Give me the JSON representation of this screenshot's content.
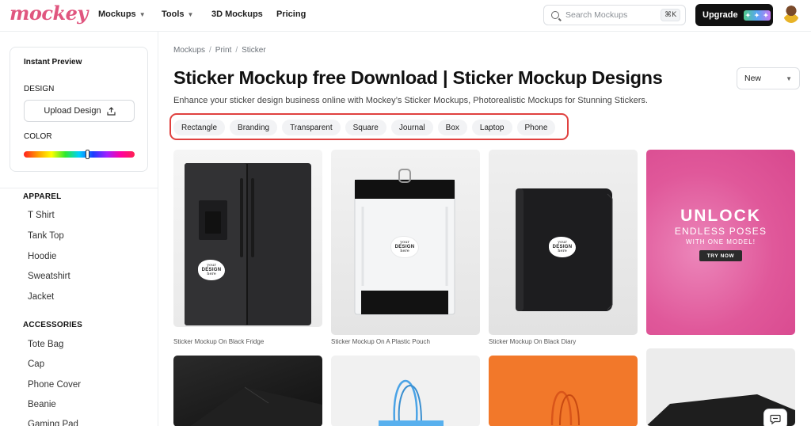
{
  "brand": {
    "logo": "mockey"
  },
  "nav": {
    "items": [
      {
        "label": "Mockups",
        "dropdown": true
      },
      {
        "label": "Tools",
        "dropdown": true
      },
      {
        "label": "3D Mockups",
        "dropdown": false
      },
      {
        "label": "Pricing",
        "dropdown": false
      }
    ]
  },
  "search": {
    "placeholder": "Search Mockups",
    "shortcut": "⌘K"
  },
  "upgrade": {
    "label": "Upgrade"
  },
  "sidebar": {
    "preview": {
      "title": "Instant Preview",
      "design_label": "DESIGN",
      "upload_label": "Upload Design",
      "color_label": "COLOR"
    },
    "sections": [
      {
        "heading": "APPAREL",
        "items": [
          "T Shirt",
          "Tank Top",
          "Hoodie",
          "Sweatshirt",
          "Jacket"
        ]
      },
      {
        "heading": "ACCESSORIES",
        "items": [
          "Tote Bag",
          "Cap",
          "Phone Cover",
          "Beanie",
          "Gaming Pad"
        ]
      }
    ]
  },
  "breadcrumb": [
    "Mockups",
    "Print",
    "Sticker"
  ],
  "page": {
    "title": "Sticker Mockup free Download | Sticker Mockup Designs",
    "subtitle": "Enhance your sticker design business online with Mockey’s Sticker Mockups, Photorealistic Mockups for Stunning Stickers."
  },
  "sort": {
    "selected": "New"
  },
  "tags": [
    "Rectangle",
    "Branding",
    "Transparent",
    "Square",
    "Journal",
    "Box",
    "Laptop",
    "Phone"
  ],
  "sticker_text": {
    "line1": "your",
    "line2": "DESIGN",
    "line3": "here"
  },
  "cards": [
    {
      "label": "Sticker Mockup On Black Fridge"
    },
    {
      "label": "Sticker Mockup On A Plastic Pouch"
    },
    {
      "label": "Sticker Mockup On Black Diary"
    }
  ],
  "promo": {
    "headline": "UNLOCK",
    "line2": "ENDLESS POSES",
    "line3": "WITH ONE MODEL!",
    "cta": "TRY NOW"
  },
  "colors": {
    "brand": "#e0567f",
    "highlight_border": "#e0413f",
    "promo_bg": "#e0589a",
    "orange_tile": "#f2782a"
  }
}
